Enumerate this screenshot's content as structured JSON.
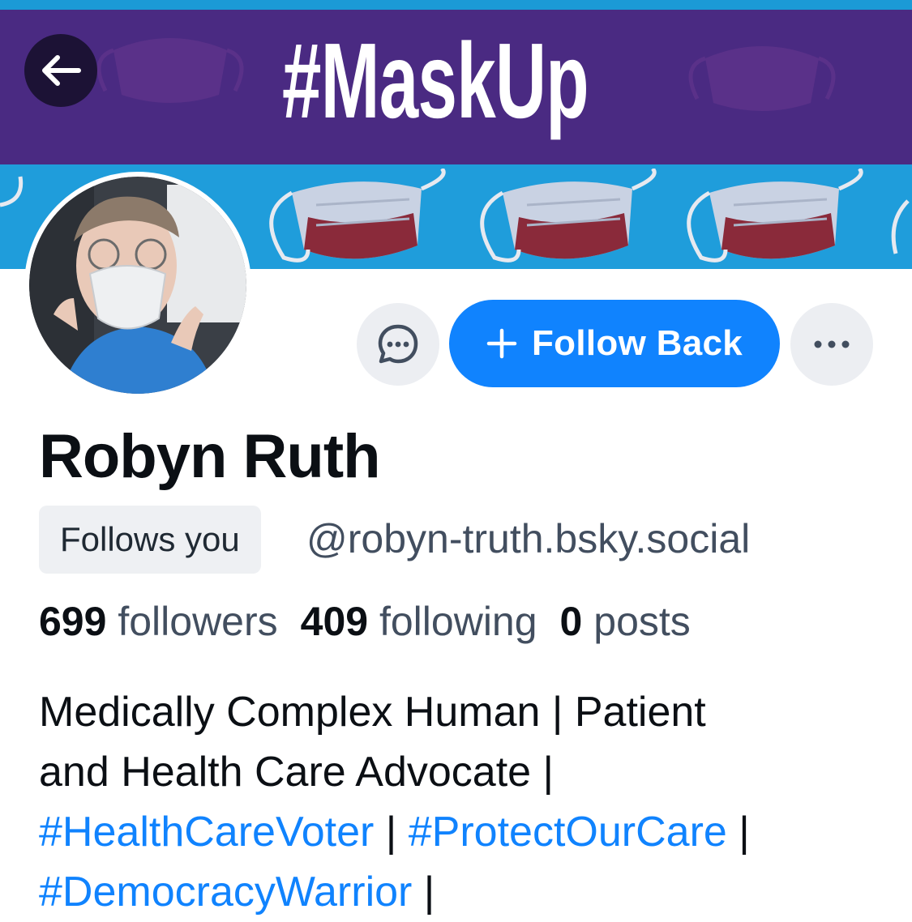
{
  "banner": {
    "title": "#MaskUp",
    "colors": {
      "purple": "#4a2a82",
      "blue": "#1f9ddb"
    }
  },
  "nav": {
    "back_icon": "arrow-left-icon"
  },
  "actions": {
    "message_icon": "chat-bubble-icon",
    "follow_back_label": "Follow Back",
    "follow_icon": "plus-icon",
    "more_icon": "ellipsis-icon",
    "accent_color": "#1083fe"
  },
  "profile": {
    "display_name": "Robyn Ruth",
    "follows_you_badge": "Follows you",
    "handle": "@robyn-truth.bsky.social",
    "stats": {
      "followers_count": "699",
      "followers_label": "followers",
      "following_count": "409",
      "following_label": "following",
      "posts_count": "0",
      "posts_label": "posts"
    },
    "bio": {
      "line1": "Medically Complex Human | Patient",
      "line2": "and Health Care Advocate |",
      "tag1": "#HealthCareVoter",
      "sep1": " | ",
      "tag2": "#ProtectOurCare",
      "sep2": " |",
      "tag3": "#DemocracyWarrior",
      "sep3": " |"
    }
  }
}
